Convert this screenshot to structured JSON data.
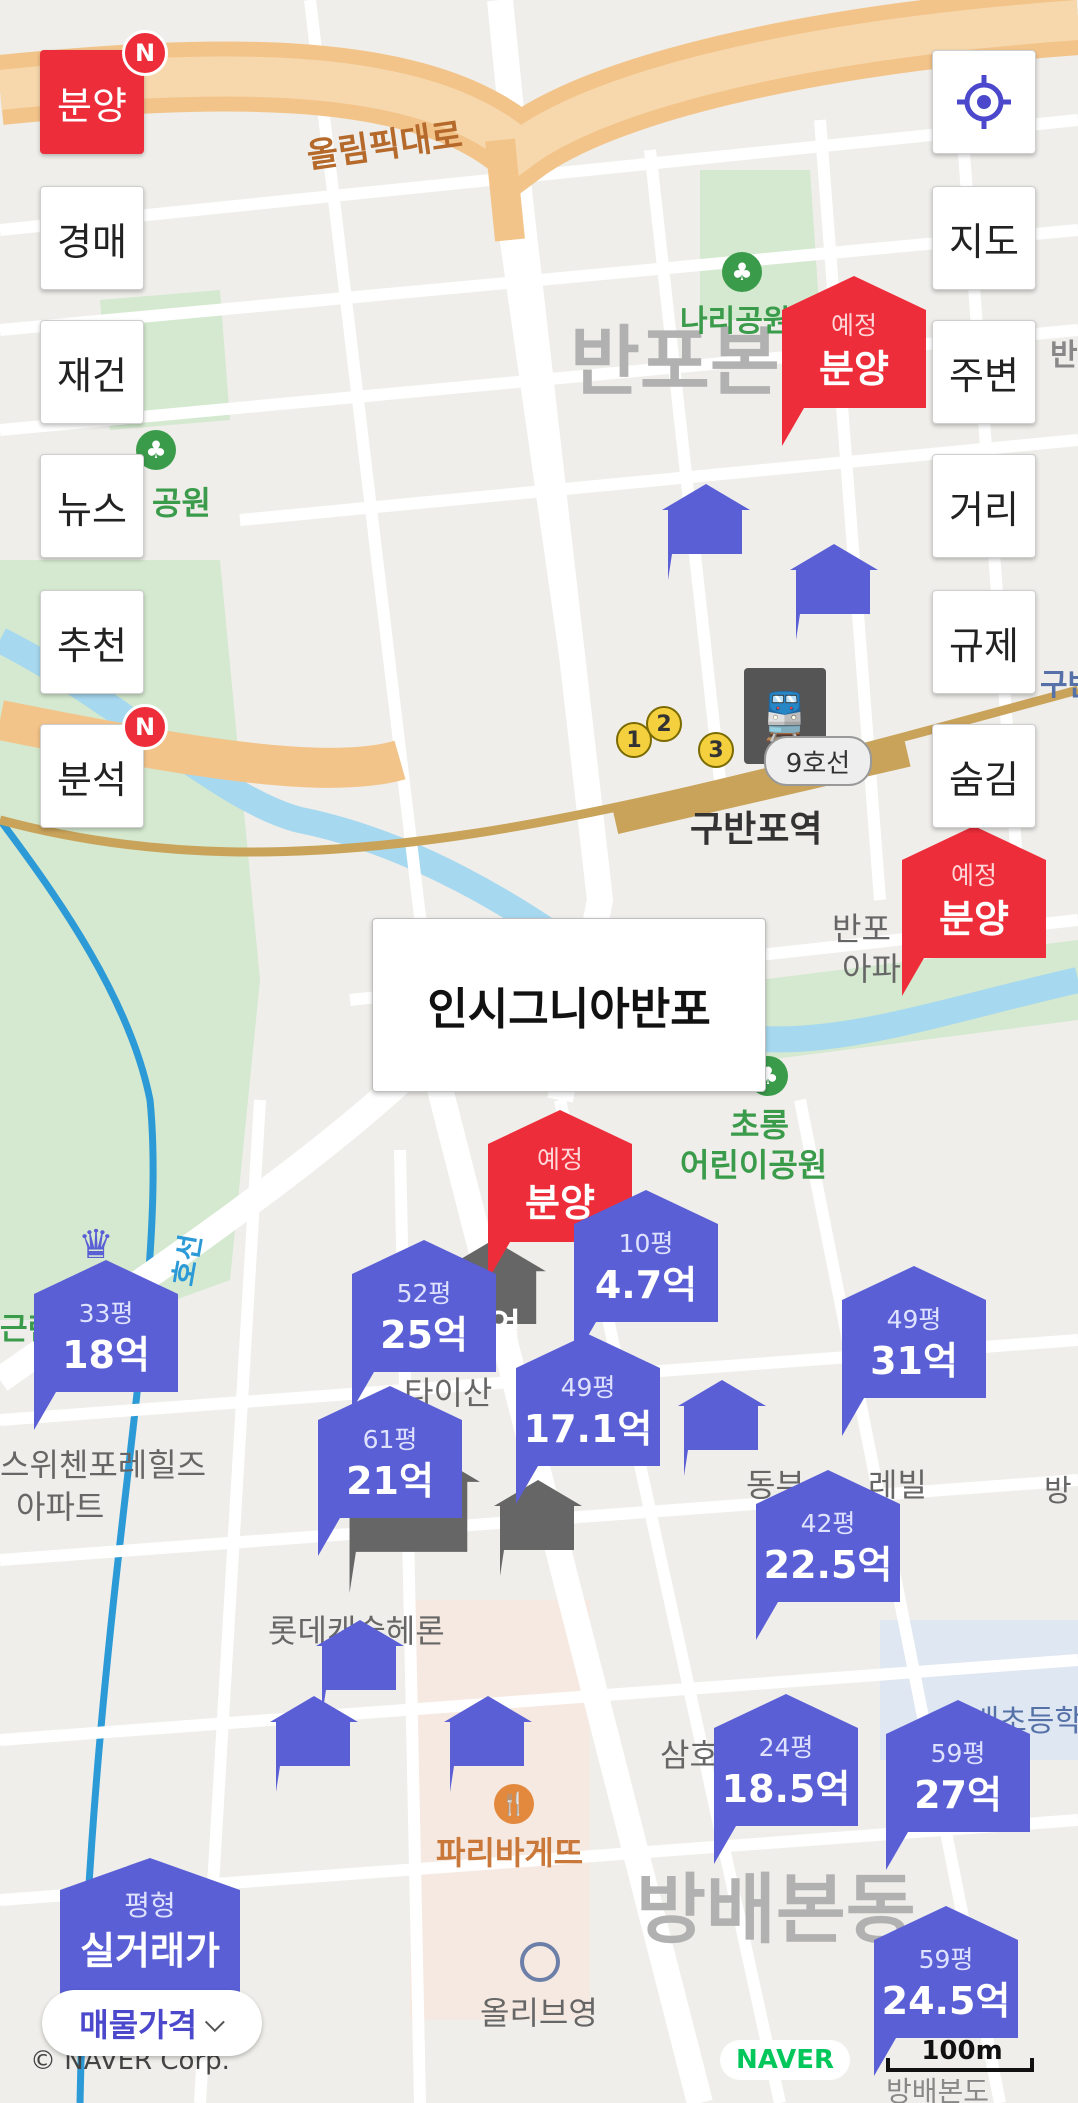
{
  "map": {
    "road_labels": {
      "olympic_road": "올림픽대로"
    },
    "district_labels": {
      "banpo": "반포본",
      "bangbae": "방배본동"
    },
    "poi": {
      "nari_park": "나리공원",
      "park_left": "공원",
      "station": "구반포역",
      "line_badge": "9호선",
      "exit_numbers": [
        "1",
        "2",
        "3"
      ],
      "banpo_apt_line1": "반포",
      "banpo_apt_line2": "아파",
      "chorong_line1": "초롱",
      "chorong_line2": "어린이공원",
      "switzen_line1": "스위첸포레힐즈",
      "switzen_line2": "아파트",
      "lotte_castle": "롯데캐슬헤론",
      "paris_baguette": "파리바게뜨",
      "olive_young": "올리브영",
      "samho": "삼호",
      "dongbu": "동부",
      "dongbu_right": "레빌",
      "elem_school": "방배초등학",
      "geun": "근린",
      "right_edge1": "반",
      "right_edge2": "구반",
      "right_edge3": "방",
      "hoseon": "호선",
      "bottom_road": "방배본도",
      "partial_eok": "억",
      "partial_taean": "타이산"
    },
    "copyright": "© NAVER Corp.",
    "naver_logo": "NAVER",
    "scale_label": "100m"
  },
  "left_controls": [
    {
      "label": "분양",
      "badge": "N",
      "active": true
    },
    {
      "label": "경매"
    },
    {
      "label": "재건"
    },
    {
      "label": "뉴스"
    },
    {
      "label": "추천"
    },
    {
      "label": "분석",
      "badge": "N"
    }
  ],
  "right_controls": {
    "locate_icon": "crosshair-icon",
    "buttons": [
      "지도",
      "주변",
      "거리",
      "규제",
      "숨김"
    ]
  },
  "popup": {
    "title": "인시그니아반포"
  },
  "price_markers": [
    {
      "size": "33평",
      "price": "18억",
      "crown": true
    },
    {
      "size": "52평",
      "price": "25억"
    },
    {
      "size": "10평",
      "price": "4.7억"
    },
    {
      "size": "49평",
      "price": "17.1억"
    },
    {
      "size": "61평",
      "price": "21억"
    },
    {
      "size": "49평",
      "price": "31억"
    },
    {
      "size": "42평",
      "price": "22.5억"
    },
    {
      "size": "24평",
      "price": "18.5억"
    },
    {
      "size": "59평",
      "price": "27억"
    },
    {
      "size": "59평",
      "price": "24.5억"
    }
  ],
  "presale_markers": [
    {
      "line1": "예정",
      "line2": "분양"
    },
    {
      "line1": "예정",
      "line2": "분양"
    },
    {
      "line1": "예정",
      "line2": "분양"
    }
  ],
  "bottom_marker": {
    "line1": "평형",
    "line2": "실거래가"
  },
  "price_toggle": {
    "label": "매물가격",
    "icon": "chevron-down-icon"
  },
  "colors": {
    "marker_blue": "#5a5fd6",
    "marker_red": "#ee2d3a",
    "water": "#a6d8f0",
    "road": "#ffffff",
    "park": "#cfe8c9"
  }
}
